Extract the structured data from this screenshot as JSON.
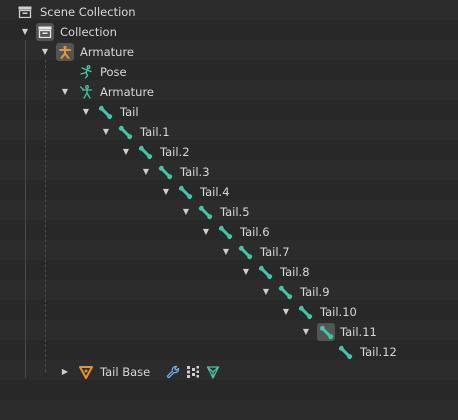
{
  "colors": {
    "background": "#282828",
    "stripe": "#2c2c2c",
    "bone": "#3fc7a6",
    "armature_orange": "#e6952f",
    "mesh_orange": "#e6952f",
    "modifier_blue": "#6aa7e8",
    "text": "#d8d8d8"
  },
  "outliner": {
    "scene_collection": {
      "label": "Scene Collection",
      "icon": "scene-collection-icon"
    },
    "collection": {
      "label": "Collection",
      "icon": "collection-icon"
    },
    "armature_object": {
      "label": "Armature",
      "icon": "armature-object-icon"
    },
    "pose": {
      "label": "Pose",
      "icon": "pose-icon"
    },
    "armature_data": {
      "label": "Armature",
      "icon": "armature-data-icon"
    },
    "bones": [
      "Tail",
      "Tail.1",
      "Tail.2",
      "Tail.3",
      "Tail.4",
      "Tail.5",
      "Tail.6",
      "Tail.7",
      "Tail.8",
      "Tail.9",
      "Tail.10",
      "Tail.11",
      "Tail.12"
    ],
    "active_bone": "Tail.11",
    "tail_base": {
      "label": "Tail Base",
      "icon": "mesh-object-icon",
      "extras": [
        "wrench-modifier-icon",
        "vertex-groups-icon",
        "mesh-data-icon"
      ]
    }
  }
}
